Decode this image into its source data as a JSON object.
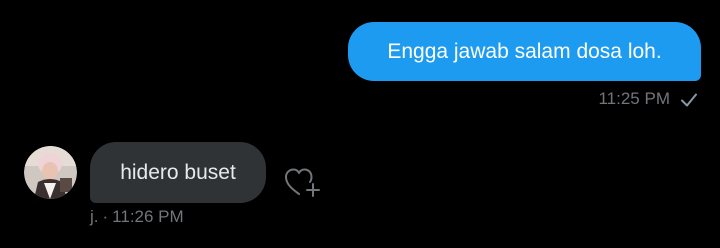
{
  "conversation": {
    "outgoing": {
      "text": "Engga jawab salam dosa loh.",
      "time": "11:25 PM",
      "status_icon": "checkmark-icon"
    },
    "incoming": {
      "sender": "j.",
      "separator": "·",
      "text": "hidero buset",
      "time": "11:26 PM",
      "avatar_icon": "user-avatar",
      "reaction_icon": "heart-plus-icon"
    }
  },
  "colors": {
    "background": "#000000",
    "outgoing_bubble": "#1d9bf0",
    "incoming_bubble": "#2f3336",
    "meta_text": "#71767b"
  }
}
